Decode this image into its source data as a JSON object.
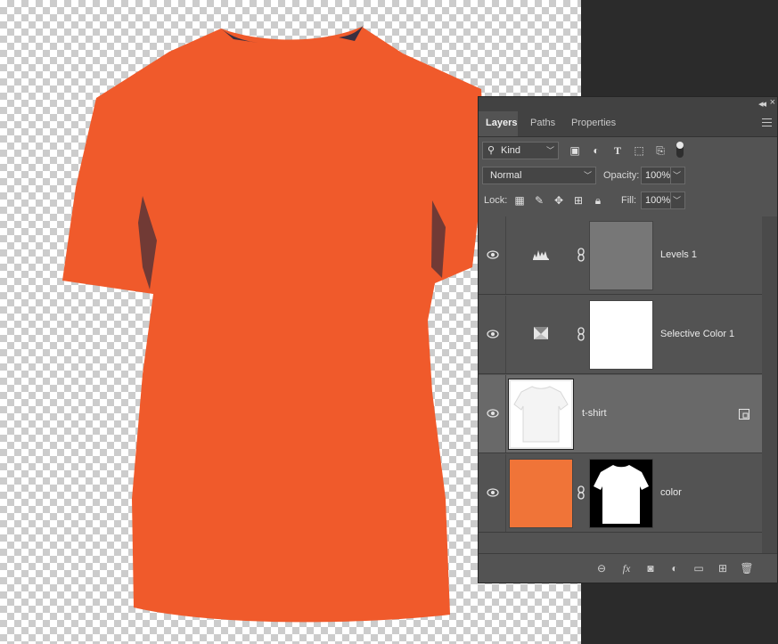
{
  "tabs": [
    {
      "label": "Layers",
      "active": true
    },
    {
      "label": "Paths",
      "active": false
    },
    {
      "label": "Properties",
      "active": false
    }
  ],
  "filter": {
    "kind_label": "Kind"
  },
  "blend": {
    "mode": "Normal",
    "opacity_label": "Opacity:",
    "opacity_value": "100%"
  },
  "lock": {
    "label": "Lock:",
    "fill_label": "Fill:",
    "fill_value": "100%"
  },
  "layers": [
    {
      "name": "Levels 1",
      "type": "adjustment",
      "icon": "levels-icon",
      "visible": true,
      "selected": false
    },
    {
      "name": "Selective Color 1",
      "type": "adjustment",
      "icon": "selective-color-icon",
      "visible": true,
      "selected": false
    },
    {
      "name": "t-shirt",
      "type": "smart-object",
      "icon": "smart-object-icon",
      "visible": true,
      "selected": true
    },
    {
      "name": "color",
      "type": "fill",
      "icon": "layer-mask-icon",
      "visible": true,
      "selected": false
    }
  ],
  "colors": {
    "shirt": "#f05a2b",
    "fill": "#f07438",
    "panel": "#535353",
    "selected": "#696969"
  }
}
